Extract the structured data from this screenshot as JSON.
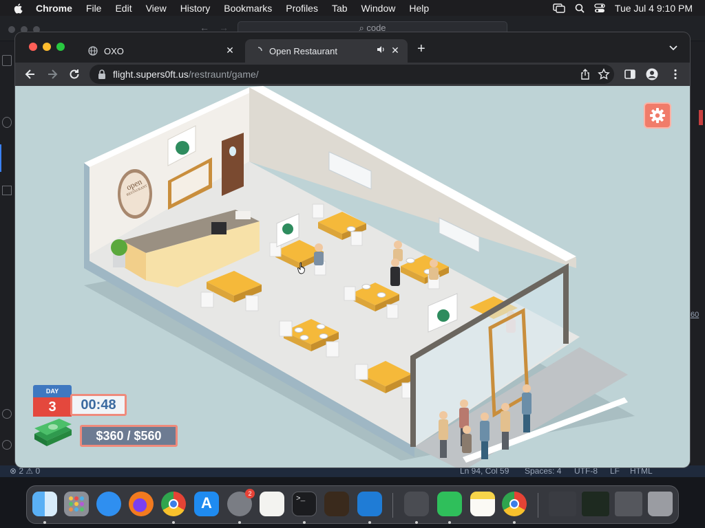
{
  "menubar": {
    "app": "Chrome",
    "items": [
      "File",
      "Edit",
      "View",
      "History",
      "Bookmarks",
      "Profiles",
      "Tab",
      "Window",
      "Help"
    ],
    "clock": "Tue Jul 4  9:10 PM"
  },
  "vscode": {
    "search_text": "code",
    "status": {
      "problems": "⊗ 2 ⚠ 0",
      "position": "Ln 94, Col 59",
      "spaces": "Spaces: 4",
      "encoding": "UTF-8",
      "eol": "LF",
      "language": "HTML"
    },
    "side_text": "60"
  },
  "browser": {
    "tabs": [
      {
        "label": "OXO",
        "active": false
      },
      {
        "label": "Open Restaurant",
        "active": true
      }
    ],
    "url_host": "flight.supers0ft.us",
    "url_path": "/restraunt/game/"
  },
  "game": {
    "day_label": "DAY",
    "day": "3",
    "timer": "00:48",
    "money": "$360 / $560",
    "logo_top": "open",
    "logo_bottom": "RESTAURANT"
  },
  "dock": {
    "apps": [
      "finder",
      "launchpad",
      "safari",
      "firefox",
      "chrome",
      "app-store",
      "system-settings",
      "textedit",
      "terminal",
      "garageband",
      "vscode",
      "calculator",
      "numbers",
      "notes",
      "chrome-2"
    ],
    "settings_badge": "2"
  },
  "colors": {
    "table": "#f5b93a",
    "floor": "#e6e6e6",
    "wall": "#f4f1ec",
    "viewport_bg": "#bed3d6",
    "settings": "#f07c6a"
  }
}
